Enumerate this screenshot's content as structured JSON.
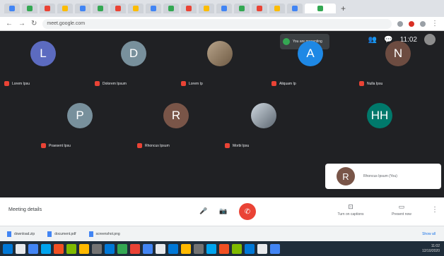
{
  "browser": {
    "tab_colors": [
      "#4285f4",
      "#34a853",
      "#ea4335",
      "#fbbc05",
      "#4285f4",
      "#34a853",
      "#ea4335",
      "#fbbc05",
      "#4285f4",
      "#34a853",
      "#ea4335",
      "#fbbc05",
      "#4285f4",
      "#34a853",
      "#ea4335",
      "#fbbc05",
      "#4285f4",
      "#34a853"
    ],
    "new_tab_label": "+",
    "back_glyph": "←",
    "forward_glyph": "→",
    "reload_glyph": "↻",
    "url": "meet.google.com"
  },
  "meeting": {
    "presenting_text": "You are presenting",
    "participants": [
      {
        "initial": "L",
        "color": "#5c6bc0",
        "name": "Lorem Ipsu"
      },
      {
        "initial": "D",
        "color": "#78909c",
        "name": "Dolorem Ipsum"
      },
      {
        "initial": "",
        "color": "photo1",
        "name": "Lorem Ip"
      },
      {
        "initial": "A",
        "color": "#1e88e5",
        "name": "Aliquam Ip"
      },
      {
        "initial": "N",
        "color": "#6d4c41",
        "name": "Nulla Ipsu"
      },
      {
        "initial": "P",
        "color": "#78909c",
        "name": "Praesent Ipsu"
      },
      {
        "initial": "R",
        "color": "#795548",
        "name": "Rhoncus Ipsum"
      },
      {
        "initial": "",
        "color": "photo2",
        "name": "Morbi Ipsu"
      },
      {
        "initial": "HH",
        "color": "#00796b",
        "name": ""
      }
    ],
    "self_initial": "R",
    "self_label": "Rhoncus Ipsum (You)",
    "title": "Meeting details",
    "controls": {
      "mic": "🎤",
      "camera": "📷",
      "hangup": "✆",
      "captions_label": "Turn on captions",
      "present_label": "Present now",
      "more": "⋮"
    }
  },
  "top_icons": {
    "people": "👥",
    "chat": "💬",
    "time": "11:02"
  },
  "downloads": [
    {
      "name": "download.zip"
    },
    {
      "name": "document.pdf"
    },
    {
      "name": "screenshot.png"
    }
  ],
  "downloads_show_all": "Show all",
  "taskbar": {
    "icons": [
      "#0078d7",
      "#e8eaed",
      "#4285f4",
      "#00a4ef",
      "#f25022",
      "#7fba00",
      "#ffb900",
      "#737373",
      "#0078d7",
      "#34a853",
      "#ea4335",
      "#4285f4",
      "#e8eaed",
      "#0078d7",
      "#ffb900",
      "#737373",
      "#00a4ef",
      "#f25022",
      "#7fba00",
      "#0078d7",
      "#e8eaed",
      "#4285f4"
    ],
    "tray_time": "11:02",
    "tray_date": "12/10/2020"
  }
}
